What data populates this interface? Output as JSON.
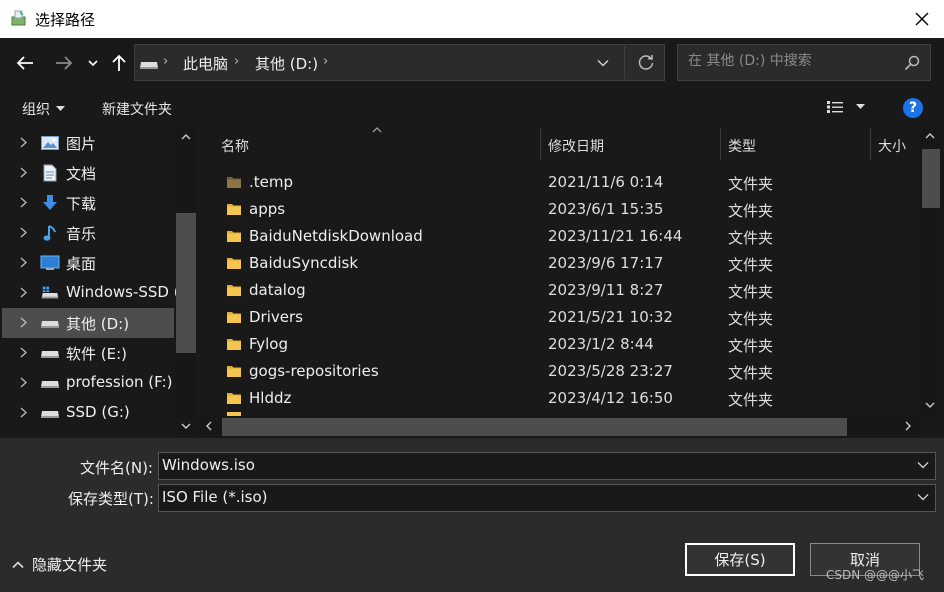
{
  "window": {
    "title": "选择路径",
    "close_glyph": "✕",
    "icon": "save-dialog-icon"
  },
  "nav": {
    "back_icon": "arrow-left-icon",
    "forward_icon": "arrow-right-icon",
    "up_icon": "arrow-up-icon"
  },
  "address": {
    "crumbs": [
      "此电脑",
      "其他 (D:)"
    ],
    "separator": "›"
  },
  "search": {
    "placeholder": "在 其他 (D:) 中搜索"
  },
  "toolbar": {
    "organize_label": "组织",
    "new_folder_label": "新建文件夹",
    "help_label": "?"
  },
  "sidebar": {
    "items": [
      {
        "label": "图片",
        "icon": "pictures-icon"
      },
      {
        "label": "文档",
        "icon": "documents-icon"
      },
      {
        "label": "下载",
        "icon": "downloads-icon"
      },
      {
        "label": "音乐",
        "icon": "music-icon"
      },
      {
        "label": "桌面",
        "icon": "desktop-icon"
      },
      {
        "label": "Windows-SSD (",
        "icon": "windows-drive-icon"
      },
      {
        "label": "其他 (D:)",
        "icon": "drive-icon",
        "selected": true
      },
      {
        "label": "软件 (E:)",
        "icon": "drive-icon"
      },
      {
        "label": "profession (F:)",
        "icon": "drive-icon"
      },
      {
        "label": "SSD (G:)",
        "icon": "drive-icon"
      }
    ]
  },
  "columns": {
    "name": "名称",
    "date": "修改日期",
    "type": "类型",
    "size": "大小"
  },
  "files": [
    {
      "name": ".temp",
      "date": "2021/11/6 0:14",
      "type": "文件夹",
      "hidden": true
    },
    {
      "name": "apps",
      "date": "2023/6/1 15:35",
      "type": "文件夹"
    },
    {
      "name": "BaiduNetdiskDownload",
      "date": "2023/11/21 16:44",
      "type": "文件夹"
    },
    {
      "name": "BaiduSyncdisk",
      "date": "2023/9/6 17:17",
      "type": "文件夹"
    },
    {
      "name": "datalog",
      "date": "2023/9/11 8:27",
      "type": "文件夹"
    },
    {
      "name": "Drivers",
      "date": "2021/5/21 10:32",
      "type": "文件夹"
    },
    {
      "name": "Fylog",
      "date": "2023/1/2 8:44",
      "type": "文件夹"
    },
    {
      "name": "gogs-repositories",
      "date": "2023/5/28 23:27",
      "type": "文件夹"
    },
    {
      "name": "Hlddz",
      "date": "2023/4/12 16:50",
      "type": "文件夹"
    }
  ],
  "form": {
    "filename_label": "文件名(N):",
    "filename_value": "Windows.iso",
    "filetype_label": "保存类型(T):",
    "filetype_value": "ISO File (*.iso)"
  },
  "footer": {
    "hide_folders_label": "隐藏文件夹",
    "save_label": "保存(S)",
    "cancel_label": "取消",
    "watermark": "CSDN @@@小飞"
  },
  "colors": {
    "background": "#191919",
    "panel": "#2b2b2b",
    "folder": "#f4c64f",
    "accent": "#1a73e8"
  }
}
